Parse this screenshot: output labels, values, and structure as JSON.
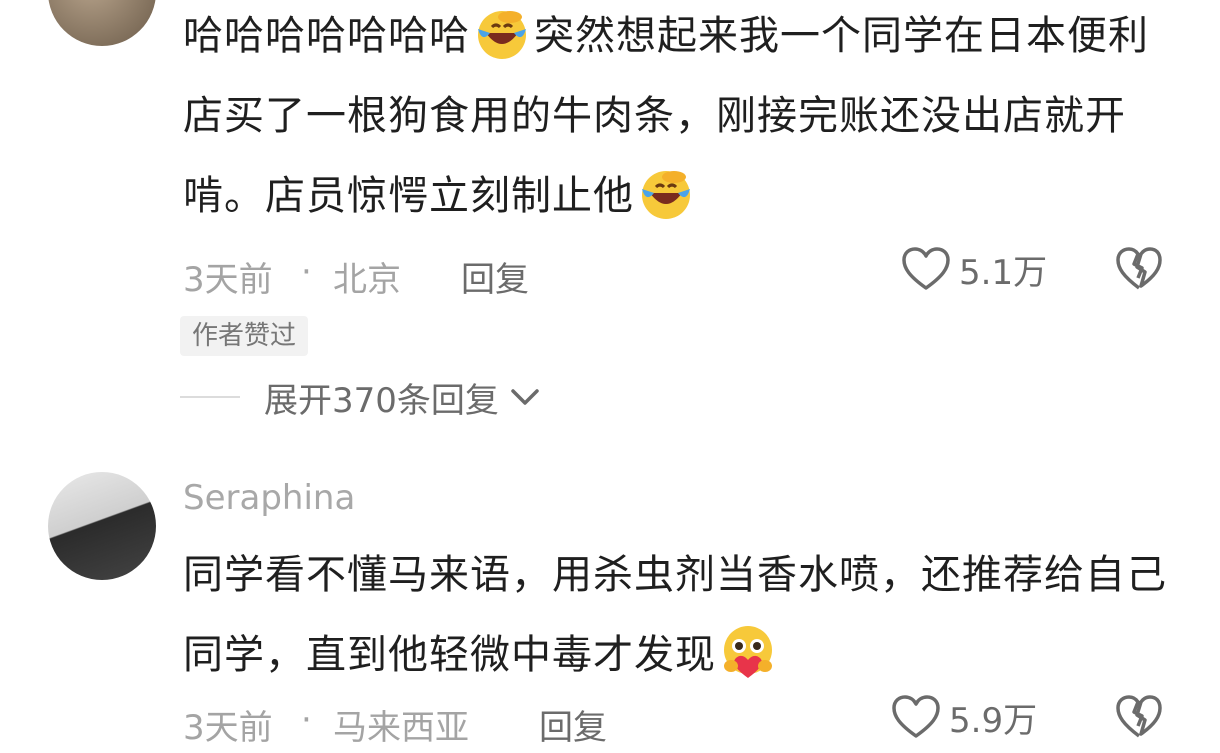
{
  "comments": [
    {
      "username": "",
      "text_parts": [
        "哈哈哈哈哈哈哈",
        "突然想起来我一个同学在日本便利店买了一根狗食用的牛肉条，刚接完账还没出店就开啃。店员惊愕立刻制止他"
      ],
      "emojis": [
        "laugh-cry-emoji",
        "laugh-cry-emoji"
      ],
      "time": "3天前",
      "separator": "·",
      "location": "北京",
      "reply_label": "回复",
      "likes": "5.1万",
      "badge": "作者赞过",
      "expand_label": "展开370条回复"
    },
    {
      "username": "Seraphina",
      "text_parts": [
        "同学看不懂马来语，用杀虫剂当香水喷，还推荐给自己同学，直到他轻微中毒才发现"
      ],
      "emojis": [
        "heart-hug-emoji"
      ],
      "time": "3天前",
      "separator": "·",
      "location": "马来西亚",
      "reply_label": "回复",
      "likes": "5.9万"
    }
  ],
  "colors": {
    "text": "#1f1f1f",
    "meta": "#a4a4a4",
    "action": "#6b6b6b",
    "emoji_face": "#f7c93a",
    "emoji_tears": "#4aa3e8",
    "emoji_heart": "#e8344a"
  }
}
